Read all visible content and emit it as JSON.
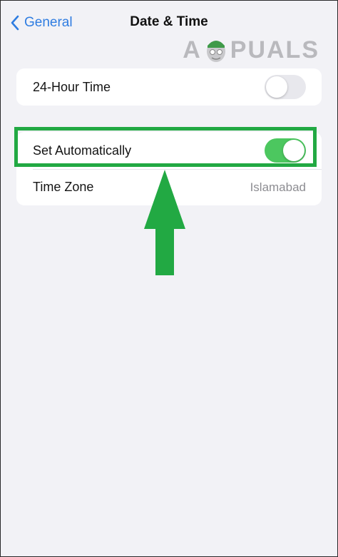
{
  "nav": {
    "back_label": "General",
    "title": "Date & Time"
  },
  "watermark": {
    "left": "A",
    "right": "PUALS"
  },
  "settings": {
    "hour24": {
      "label": "24-Hour Time",
      "enabled": false
    },
    "set_automatically": {
      "label": "Set Automatically",
      "enabled": true
    },
    "time_zone": {
      "label": "Time Zone",
      "value": "Islamabad"
    }
  },
  "colors": {
    "accent": "#2f7de1",
    "toggle_on": "#4cc75f",
    "toggle_off": "#e8e8ed",
    "highlight": "#22a943",
    "background": "#f2f2f6"
  },
  "icons": {
    "back": "chevron-left-icon",
    "annotation": "arrow-up-icon"
  }
}
